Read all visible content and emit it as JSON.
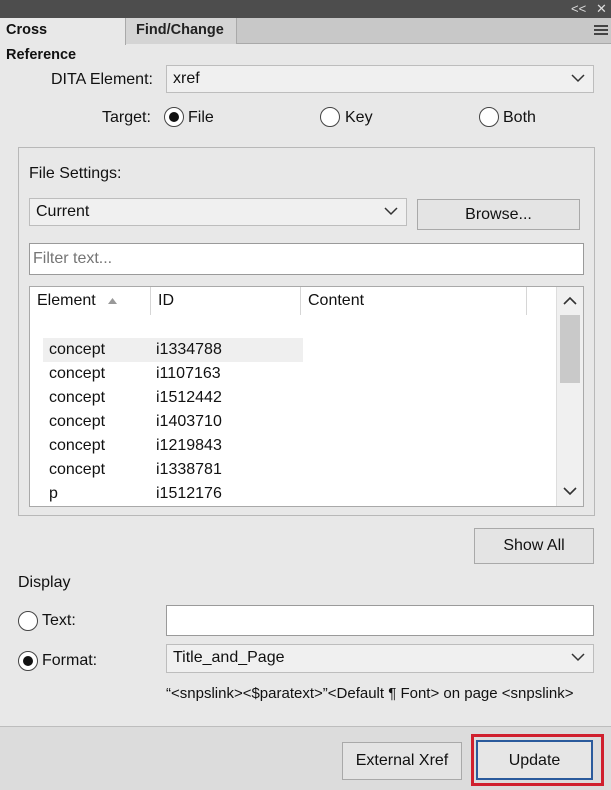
{
  "panel": {
    "collapse_glyph": "<<",
    "close_glyph": "✕",
    "tabs": [
      "Cross Reference",
      "Find/Change"
    ]
  },
  "dita": {
    "label": "DITA Element:",
    "value": "xref"
  },
  "target": {
    "label": "Target:",
    "options": [
      "File",
      "Key",
      "Both"
    ],
    "selected": "File"
  },
  "file_settings": {
    "label": "File Settings:",
    "source_value": "Current",
    "browse_label": "Browse...",
    "filter_placeholder": "Filter text..."
  },
  "table": {
    "columns": [
      "Element",
      "ID",
      "Content"
    ],
    "sort_column": "Element",
    "rows": [
      {
        "element": "concept",
        "id": "i1334788",
        "content": "",
        "selected": true
      },
      {
        "element": "concept",
        "id": "i1107163",
        "content": ""
      },
      {
        "element": "concept",
        "id": "i1512442",
        "content": ""
      },
      {
        "element": "concept",
        "id": "i1403710",
        "content": ""
      },
      {
        "element": "concept",
        "id": "i1219843",
        "content": ""
      },
      {
        "element": "concept",
        "id": "i1338781",
        "content": ""
      },
      {
        "element": "p",
        "id": "i1512176",
        "content": ""
      }
    ]
  },
  "show_all_label": "Show All",
  "display": {
    "label": "Display",
    "text_label": "Text:",
    "text_value": "",
    "format_label": "Format:",
    "format_value": "Title_and_Page",
    "selected": "Format",
    "preview": "“<snpslink><$paratext>”<Default ¶ Font> on page <snpslink>"
  },
  "footer": {
    "external_xref_label": "External Xref",
    "update_label": "Update"
  },
  "colors": {
    "highlight_border": "#d0202e",
    "update_button_border": "#2a5a9c"
  }
}
